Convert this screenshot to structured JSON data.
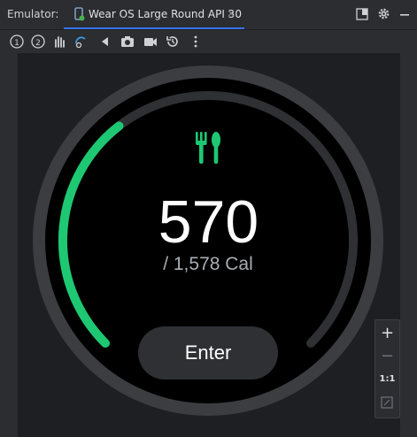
{
  "window": {
    "tool_label": "Emulator:",
    "tab_title": "Wear OS Large Round API 30",
    "tab_close": "×"
  },
  "toolbar": {
    "icons": [
      "touch-1-icon",
      "touch-2-icon",
      "gesture-icon",
      "rotate-icon",
      "back-icon",
      "camera-icon",
      "video-icon",
      "history-icon",
      "more-icon"
    ]
  },
  "watch": {
    "icon": "fork-knife-icon",
    "value": "570",
    "goal": "/ 1,578 Cal",
    "button_label": "Enter",
    "progress": 0.36,
    "accent_color": "#1ec873"
  },
  "zoom": {
    "plus": "+",
    "minus": "−",
    "one_to_one": "1:1"
  }
}
